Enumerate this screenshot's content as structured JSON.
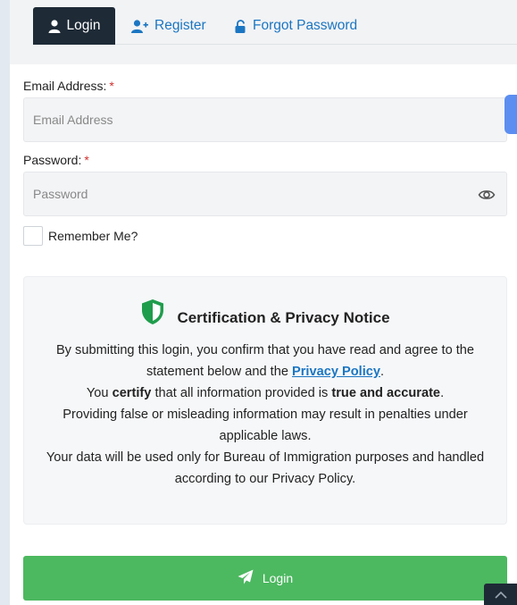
{
  "tabs": {
    "login": "Login",
    "register": "Register",
    "forgot": "Forgot Password"
  },
  "form": {
    "email_label": "Email Address:",
    "email_placeholder": "Email Address",
    "email_value": "",
    "password_label": "Password:",
    "password_placeholder": "Password",
    "password_value": "",
    "required_mark": "*",
    "remember_label": "Remember Me?",
    "remember_checked": false
  },
  "notice": {
    "title": "Certification & Privacy Notice",
    "line1": "By submitting this login, you confirm that you have read and agree to the statement below and the",
    "privacy_link": "Privacy Policy",
    "line1_end": ".",
    "line2_pre": "You",
    "line2_bold1": "certify",
    "line2_mid": "that all information provided is",
    "line2_bold2": "true and accurate",
    "line2_end": ".",
    "line3": "Providing false or misleading information may result in penalties under applicable laws.",
    "line4": "Your data will be used only for Bureau of Immigration purposes and handled according to our Privacy Policy."
  },
  "submit": {
    "label": "Login"
  },
  "colors": {
    "accent_dark": "#1e2a36",
    "link": "#1b76c2",
    "submit_green": "#4cb860",
    "shield_green": "#1f9d4c",
    "required_red": "#d03030"
  },
  "icons": {
    "login_tab": "user-icon",
    "register_tab": "user-plus-icon",
    "forgot_tab": "unlock-icon",
    "password_toggle": "eye-icon",
    "notice": "shield-icon",
    "submit": "paper-plane-icon",
    "scroll_top": "chevron-up-icon"
  }
}
